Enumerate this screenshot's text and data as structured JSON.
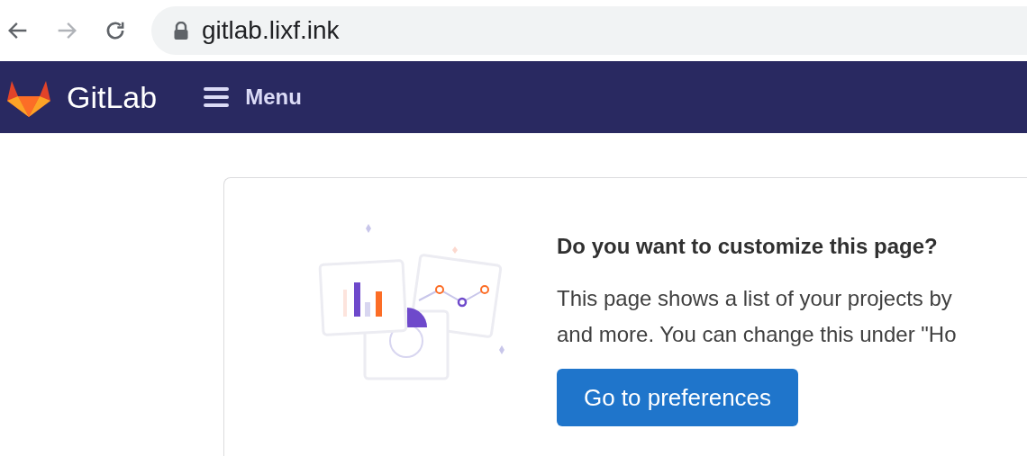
{
  "browser": {
    "url": "gitlab.lixf.ink"
  },
  "navbar": {
    "brand": "GitLab",
    "menu": "Menu"
  },
  "card": {
    "title": "Do you want to customize this page?",
    "lines": [
      "This page shows a list of your projects by",
      "and more. You can change this under \"Ho"
    ],
    "button": "Go to preferences"
  }
}
